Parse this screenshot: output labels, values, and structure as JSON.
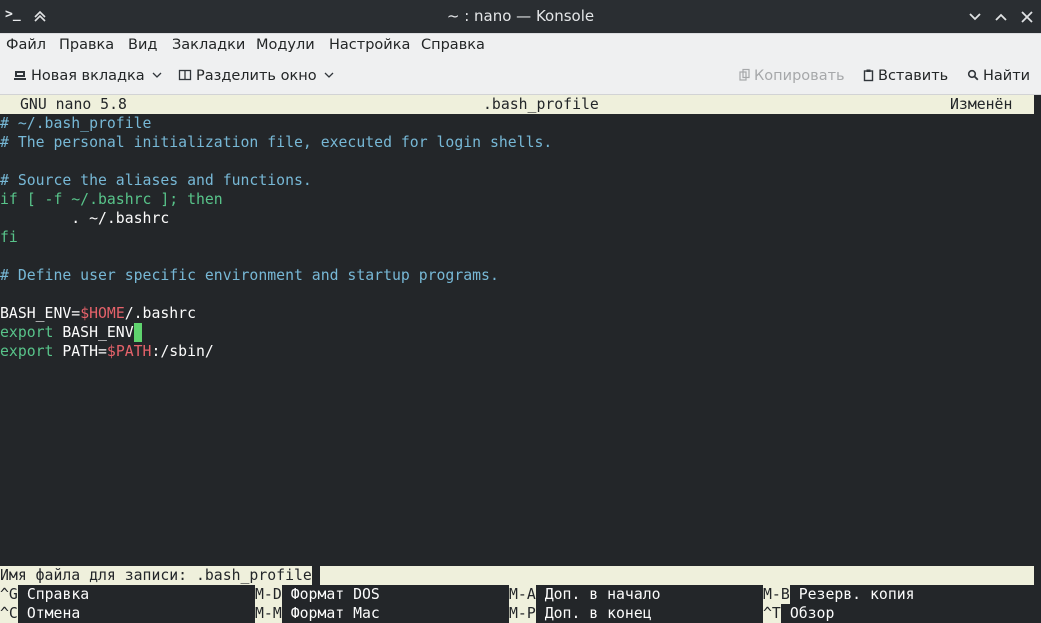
{
  "window": {
    "title": "~ : nano — Konsole"
  },
  "menubar": {
    "items": [
      "Файл",
      "Правка",
      "Вид",
      "Закладки",
      "Модули",
      "Настройка",
      "Справка"
    ]
  },
  "toolbar": {
    "new_tab": "Новая вкладка",
    "split_view": "Разделить окно",
    "copy": "Копировать",
    "paste": "Вставить",
    "find": "Найти"
  },
  "nano": {
    "version": "GNU nano 5.8",
    "filename": ".bash_profile",
    "status": "Изменён",
    "lines": [
      [
        {
          "t": "# ~/.bash_profile",
          "c": "comment"
        }
      ],
      [
        {
          "t": "# The personal initialization file, executed for login shells.",
          "c": "comment"
        }
      ],
      [],
      [
        {
          "t": "# Source the aliases and functions.",
          "c": "comment"
        }
      ],
      [
        {
          "t": "if [ -f ~/.bashrc ]; then",
          "c": "kw"
        }
      ],
      [
        {
          "t": "        . ~/.bashrc",
          "c": "plain"
        }
      ],
      [
        {
          "t": "fi",
          "c": "kw"
        }
      ],
      [],
      [
        {
          "t": "# Define user specific environment and startup programs.",
          "c": "comment"
        }
      ],
      [],
      [
        {
          "t": "BASH_ENV=",
          "c": "plain"
        },
        {
          "t": "$HOME",
          "c": "var"
        },
        {
          "t": "/.bashrc",
          "c": "plain"
        }
      ],
      [
        {
          "t": "export",
          "c": "kw"
        },
        {
          "t": " BASH_ENV",
          "c": "plain"
        }
      ],
      [
        {
          "t": "export",
          "c": "kw"
        },
        {
          "t": " PATH=",
          "c": "plain"
        },
        {
          "t": "$PATH",
          "c": "var"
        },
        {
          "t": ":/sbin/",
          "c": "plain"
        }
      ]
    ],
    "prompt": "Имя файла для записи: .bash_profile",
    "shortcuts": [
      {
        "key": "^G",
        "label": "Справка"
      },
      {
        "key": "M-D",
        "label": "Формат DOS"
      },
      {
        "key": "M-A",
        "label": "Доп. в начало"
      },
      {
        "key": "M-B",
        "label": "Резерв. копия"
      },
      {
        "key": "^C",
        "label": "Отмена"
      },
      {
        "key": "M-M",
        "label": "Формат Mac"
      },
      {
        "key": "M-P",
        "label": "Доп. в конец"
      },
      {
        "key": "^T",
        "label": "Обзор"
      }
    ]
  },
  "colors": {
    "comment": "#77b8d6",
    "keyword": "#58c48a",
    "variable": "#e5626a",
    "cursor": "#5fd36e",
    "terminal_bg": "#232629",
    "bar_bg": "#eff0dc"
  }
}
